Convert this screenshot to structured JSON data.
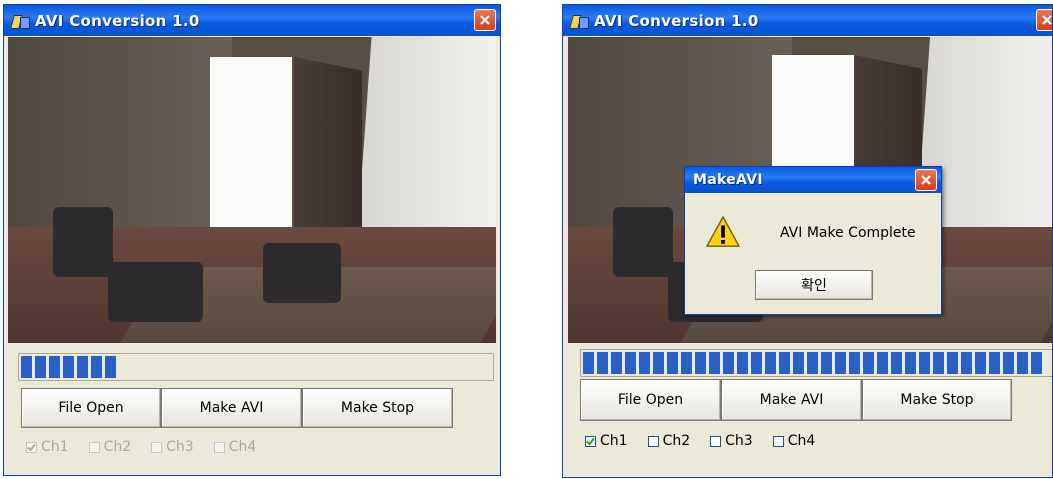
{
  "left_window": {
    "title": "AVI Conversion 1.0",
    "progress": 0.2,
    "buttons": {
      "file_open": "File Open",
      "make_avi": "Make AVI",
      "make_stop": "Make Stop"
    },
    "channels": [
      {
        "label": "Ch1",
        "checked": true
      },
      {
        "label": "Ch2",
        "checked": false
      },
      {
        "label": "Ch3",
        "checked": false
      },
      {
        "label": "Ch4",
        "checked": false
      }
    ],
    "channels_enabled": false
  },
  "right_window": {
    "title": "AVI Conversion 1.0",
    "progress": 1.0,
    "buttons": {
      "file_open": "File Open",
      "make_avi": "Make AVI",
      "make_stop": "Make Stop"
    },
    "channels": [
      {
        "label": "Ch1",
        "checked": true
      },
      {
        "label": "Ch2",
        "checked": false
      },
      {
        "label": "Ch3",
        "checked": false
      },
      {
        "label": "Ch4",
        "checked": false
      }
    ],
    "channels_enabled": true
  },
  "dialog": {
    "title": "MakeAVI",
    "message": "AVI Make Complete",
    "ok_label": "확인",
    "icon": "warning-icon"
  },
  "colors": {
    "titlebar": "#0a5ae0",
    "progress": "#2a5fc8",
    "window_bg": "#ece9d8"
  }
}
